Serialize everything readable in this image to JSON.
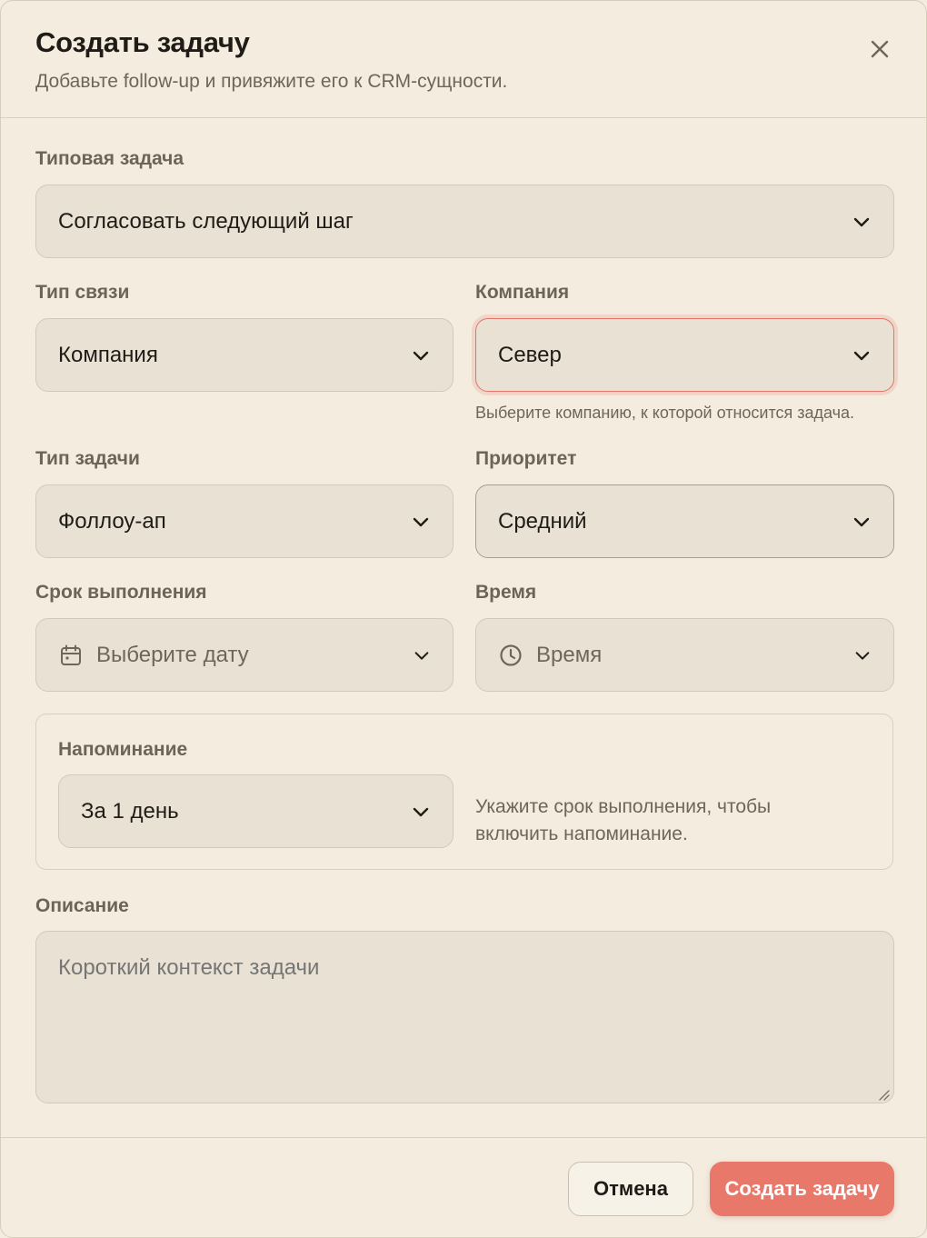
{
  "dialog": {
    "title": "Создать задачу",
    "subtitle": "Добавьте follow-up и привяжите его к CRM-сущности.",
    "close_icon": "close-icon"
  },
  "template": {
    "label": "Типовая задача",
    "value": "Согласовать следующий шаг"
  },
  "link_type": {
    "label": "Тип связи",
    "value": "Компания"
  },
  "company": {
    "label": "Компания",
    "value": "Север",
    "helper": "Выберите компанию, к которой относится задача.",
    "state": "error"
  },
  "task_type": {
    "label": "Тип задачи",
    "value": "Фоллоу-ап"
  },
  "priority": {
    "label": "Приоритет",
    "value": "Средний"
  },
  "due_date": {
    "label": "Срок выполнения",
    "placeholder": "Выберите дату",
    "icon": "calendar-icon"
  },
  "time": {
    "label": "Время",
    "placeholder": "Время",
    "icon": "clock-icon"
  },
  "reminder": {
    "label": "Напоминание",
    "value": "За 1 день",
    "hint": "Укажите срок выполнения, чтобы включить напоминание."
  },
  "description": {
    "label": "Описание",
    "placeholder": "Короткий контекст задачи"
  },
  "footer": {
    "cancel_label": "Отмена",
    "submit_label": "Создать задачу"
  },
  "colors": {
    "background": "#f3ecdf",
    "field": "#e9e2d4",
    "accent": "#e8786a",
    "error_border": "#e2746a",
    "muted_text": "#6f6659"
  }
}
